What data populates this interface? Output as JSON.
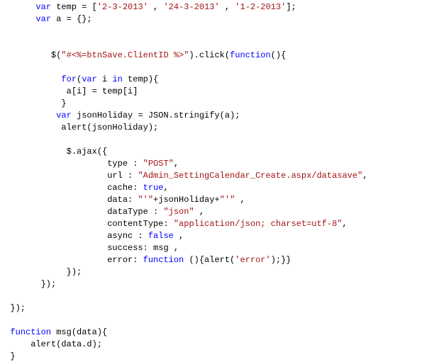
{
  "code": {
    "language": "javascript",
    "tokens": [
      [
        {
          "c": "pl",
          "t": "       "
        },
        {
          "c": "kw",
          "t": "var"
        },
        {
          "c": "pl",
          "t": " temp = ["
        },
        {
          "c": "str",
          "t": "'2-3-2013'"
        },
        {
          "c": "pl",
          "t": " , "
        },
        {
          "c": "str",
          "t": "'24-3-2013'"
        },
        {
          "c": "pl",
          "t": " , "
        },
        {
          "c": "str",
          "t": "'1-2-2013'"
        },
        {
          "c": "pl",
          "t": "];"
        }
      ],
      [
        {
          "c": "pl",
          "t": "       "
        },
        {
          "c": "kw",
          "t": "var"
        },
        {
          "c": "pl",
          "t": " a = {};"
        }
      ],
      [
        {
          "c": "pl",
          "t": ""
        }
      ],
      [
        {
          "c": "pl",
          "t": ""
        }
      ],
      [
        {
          "c": "pl",
          "t": "          $("
        },
        {
          "c": "str",
          "t": "\"#<%=btnSave.ClientID %>\""
        },
        {
          "c": "pl",
          "t": ").click("
        },
        {
          "c": "kw",
          "t": "function"
        },
        {
          "c": "pl",
          "t": "(){"
        }
      ],
      [
        {
          "c": "pl",
          "t": ""
        }
      ],
      [
        {
          "c": "pl",
          "t": "            "
        },
        {
          "c": "kw",
          "t": "for"
        },
        {
          "c": "pl",
          "t": "("
        },
        {
          "c": "kw",
          "t": "var"
        },
        {
          "c": "pl",
          "t": " i "
        },
        {
          "c": "kw",
          "t": "in"
        },
        {
          "c": "pl",
          "t": " temp){"
        }
      ],
      [
        {
          "c": "pl",
          "t": "             a[i] = temp[i]"
        }
      ],
      [
        {
          "c": "pl",
          "t": "            }"
        }
      ],
      [
        {
          "c": "pl",
          "t": "           "
        },
        {
          "c": "kw",
          "t": "var"
        },
        {
          "c": "pl",
          "t": " jsonHoliday = JSON.stringify(a);"
        }
      ],
      [
        {
          "c": "pl",
          "t": "            alert(jsonHoliday);"
        }
      ],
      [
        {
          "c": "pl",
          "t": ""
        }
      ],
      [
        {
          "c": "pl",
          "t": "             $.ajax({"
        }
      ],
      [
        {
          "c": "pl",
          "t": "                     type : "
        },
        {
          "c": "str",
          "t": "\"POST\""
        },
        {
          "c": "pl",
          "t": ","
        }
      ],
      [
        {
          "c": "pl",
          "t": "                     url : "
        },
        {
          "c": "str",
          "t": "\"Admin_SettingCalendar_Create.aspx/datasave\""
        },
        {
          "c": "pl",
          "t": ","
        }
      ],
      [
        {
          "c": "pl",
          "t": "                     cache: "
        },
        {
          "c": "kw",
          "t": "true"
        },
        {
          "c": "pl",
          "t": ","
        }
      ],
      [
        {
          "c": "pl",
          "t": "                     data: "
        },
        {
          "c": "str",
          "t": "\"'\""
        },
        {
          "c": "pl",
          "t": "+jsonHoliday+"
        },
        {
          "c": "str",
          "t": "\"'\""
        },
        {
          "c": "pl",
          "t": " ,"
        }
      ],
      [
        {
          "c": "pl",
          "t": "                     dataType : "
        },
        {
          "c": "str",
          "t": "\"json\""
        },
        {
          "c": "pl",
          "t": " ,"
        }
      ],
      [
        {
          "c": "pl",
          "t": "                     contentType: "
        },
        {
          "c": "str",
          "t": "\"application/json; charset=utf-8\""
        },
        {
          "c": "pl",
          "t": ","
        }
      ],
      [
        {
          "c": "pl",
          "t": "                     async : "
        },
        {
          "c": "kw",
          "t": "false"
        },
        {
          "c": "pl",
          "t": " ,"
        }
      ],
      [
        {
          "c": "pl",
          "t": "                     success: msg ,"
        }
      ],
      [
        {
          "c": "pl",
          "t": "                     error: "
        },
        {
          "c": "kw",
          "t": "function"
        },
        {
          "c": "pl",
          "t": " (){alert("
        },
        {
          "c": "str",
          "t": "'error'"
        },
        {
          "c": "pl",
          "t": ");}}"
        }
      ],
      [
        {
          "c": "pl",
          "t": "             });"
        }
      ],
      [
        {
          "c": "pl",
          "t": "        });"
        }
      ],
      [
        {
          "c": "pl",
          "t": ""
        }
      ],
      [
        {
          "c": "pl",
          "t": "  });"
        }
      ],
      [
        {
          "c": "pl",
          "t": ""
        }
      ],
      [
        {
          "c": "pl",
          "t": "  "
        },
        {
          "c": "kw",
          "t": "function"
        },
        {
          "c": "pl",
          "t": " msg(data){"
        }
      ],
      [
        {
          "c": "pl",
          "t": "      alert(data.d);"
        }
      ],
      [
        {
          "c": "pl",
          "t": "  }"
        }
      ]
    ]
  }
}
